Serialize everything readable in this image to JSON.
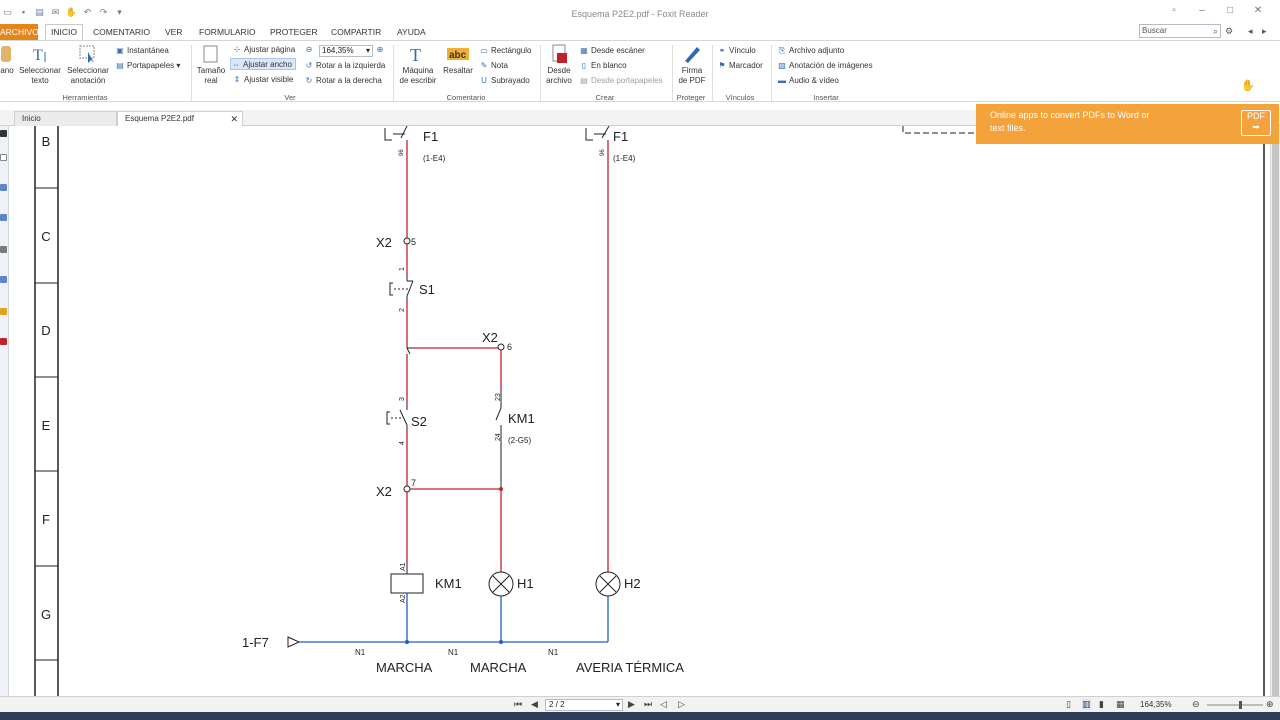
{
  "window": {
    "title": "Esquema P2E2.pdf - Foxit Reader"
  },
  "menu": {
    "archivo": "ARCHIVO",
    "tabs": [
      "INICIO",
      "COMENTARIO",
      "VER",
      "FORMULARIO",
      "PROTEGER",
      "COMPARTIR",
      "AYUDA"
    ],
    "search_placeholder": "Buscar"
  },
  "ribbon": {
    "herramientas": {
      "label": "Herramientas",
      "hand": "ano",
      "select_text": [
        "Seleccionar",
        "texto"
      ],
      "select_annot": [
        "Seleccionar",
        "anotación"
      ],
      "instantanea": "Instantánea",
      "portapapeles": "Portapapeles"
    },
    "ver": {
      "label": "Ver",
      "tamano": [
        "Tamaño",
        "real"
      ],
      "ajustar_pagina": "Ajustar página",
      "ajustar_ancho": "Ajustar ancho",
      "ajustar_visible": "Ajustar visible",
      "zoom": "164,35%",
      "rotar_izq": "Rotar a la izquierda",
      "rotar_der": "Rotar a la derecha"
    },
    "comentario": {
      "label": "Comentario",
      "maquina": [
        "Máquina",
        "de escribir"
      ],
      "resaltar": "Resaltar",
      "rectangulo": "Rectángulo",
      "nota": "Nota",
      "subrayado": "Subrayado"
    },
    "crear": {
      "label": "Crear",
      "desde_archivo": [
        "Desde",
        "archivo"
      ],
      "desde_escaner": "Desde escáner",
      "en_blanco": "En blanco",
      "desde_portapapeles": "Desde portapapeles"
    },
    "proteger": {
      "label": "Proteger",
      "firma": [
        "Firma",
        "de PDF"
      ]
    },
    "vinculos": {
      "label": "Vínculos",
      "vinculo": "Vínculo",
      "marcador": "Marcador"
    },
    "insertar": {
      "label": "Insertar",
      "archivo_adjunto": "Archivo adjunto",
      "anotacion_imagenes": "Anotación de imágenes",
      "audio_video": "Audio & vídeo"
    }
  },
  "doc_tabs": [
    {
      "label": "Inicio"
    },
    {
      "label": "Esquema P2E2.pdf"
    }
  ],
  "promo": {
    "text_line1": "Online apps to convert PDFs to Word or",
    "text_line2": "text files.",
    "badge": "PDF"
  },
  "schematic": {
    "rows": [
      "B",
      "C",
      "D",
      "E",
      "F",
      "G"
    ],
    "labels": {
      "f1_a": "F1",
      "f1_a_ref": "(1-E4)",
      "f1_b": "F1",
      "f1_b_ref": "(1-E4)",
      "x2_5": "X2",
      "t5": "5",
      "s1": "S1",
      "s1_1": "1",
      "s1_2": "2",
      "x2_6": "X2",
      "t6": "6",
      "s2": "S2",
      "s2_3": "3",
      "s2_4": "4",
      "km1_c": "KM1",
      "km1_ref": "(2-G5)",
      "km1_23": "23",
      "km1_24": "24",
      "x2_7": "X2",
      "t7": "7",
      "km1_coil": "KM1",
      "a1": "A1",
      "a2": "A2",
      "h1": "H1",
      "h2": "H2",
      "f1_num": "96",
      "f1b_num": "96",
      "ref_in": "1-F7",
      "n1_a": "N1",
      "n1_b": "N1",
      "n1_c": "N1",
      "cap1": "MARCHA",
      "cap2": "MARCHA",
      "cap3": "AVERIA TÉRMICA"
    }
  },
  "status": {
    "page": "2 / 2",
    "zoom": "164,35%"
  },
  "colors": {
    "accent": "#e3841c",
    "red_wire": "#c0222a",
    "blue_wire": "#1f5fbf"
  }
}
